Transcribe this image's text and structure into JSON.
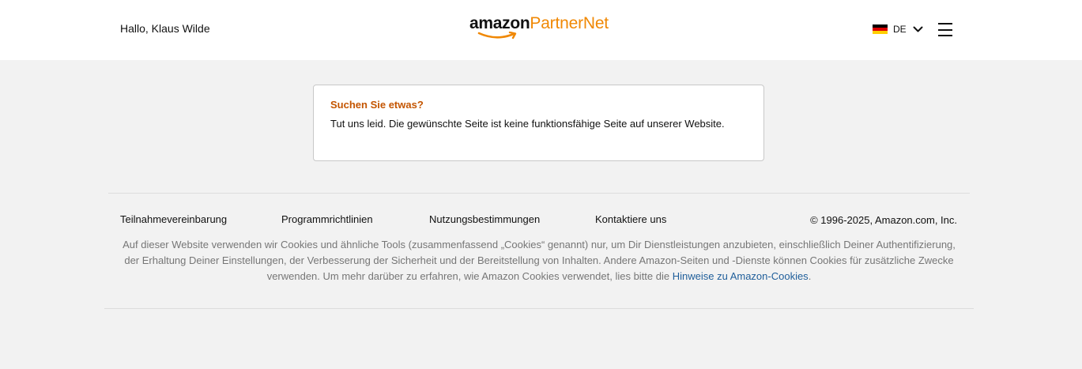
{
  "header": {
    "greeting": "Hallo, Klaus Wilde",
    "logo": {
      "word1": "amazon",
      "word2": "PartnerNet"
    },
    "language": {
      "code": "DE",
      "flag_colors": [
        "#000000",
        "#dd0000",
        "#ffce00"
      ]
    },
    "menu_icon": "hamburger-menu-icon"
  },
  "card": {
    "title": "Suchen Sie etwas?",
    "text": "Tut uns leid. Die gewünschte Seite ist keine funktionsfähige Seite auf unserer Website."
  },
  "footer": {
    "links": [
      "Teilnahmevereinbarung",
      "Programmrichtlinien",
      "Nutzungsbestimmungen",
      "Kontaktiere uns"
    ],
    "copyright": "© 1996-2025, Amazon.com, Inc.",
    "cookie_text": "Auf dieser Website verwenden wir Cookies und ähnliche Tools (zusammenfassend „Cookies“ genannt) nur, um Dir Dienstleistungen anzubieten, einschließlich Deiner Authentifizierung, der Erhaltung Deiner Einstellungen, der Verbesserung der Sicherheit und der Bereitstellung von Inhalten. Andere Amazon-Seiten und -Dienste können Cookies für zusätzliche Zwecke verwenden. Um mehr darüber zu erfahren, wie Amazon Cookies verwendet, lies bitte die ",
    "cookie_link": "Hinweise zu Amazon-Cookies",
    "cookie_end": "."
  },
  "colors": {
    "accent": "#c45500",
    "logo_orange": "#f08804",
    "link_blue": "#1f5e9a",
    "background": "#f2f2f2"
  }
}
